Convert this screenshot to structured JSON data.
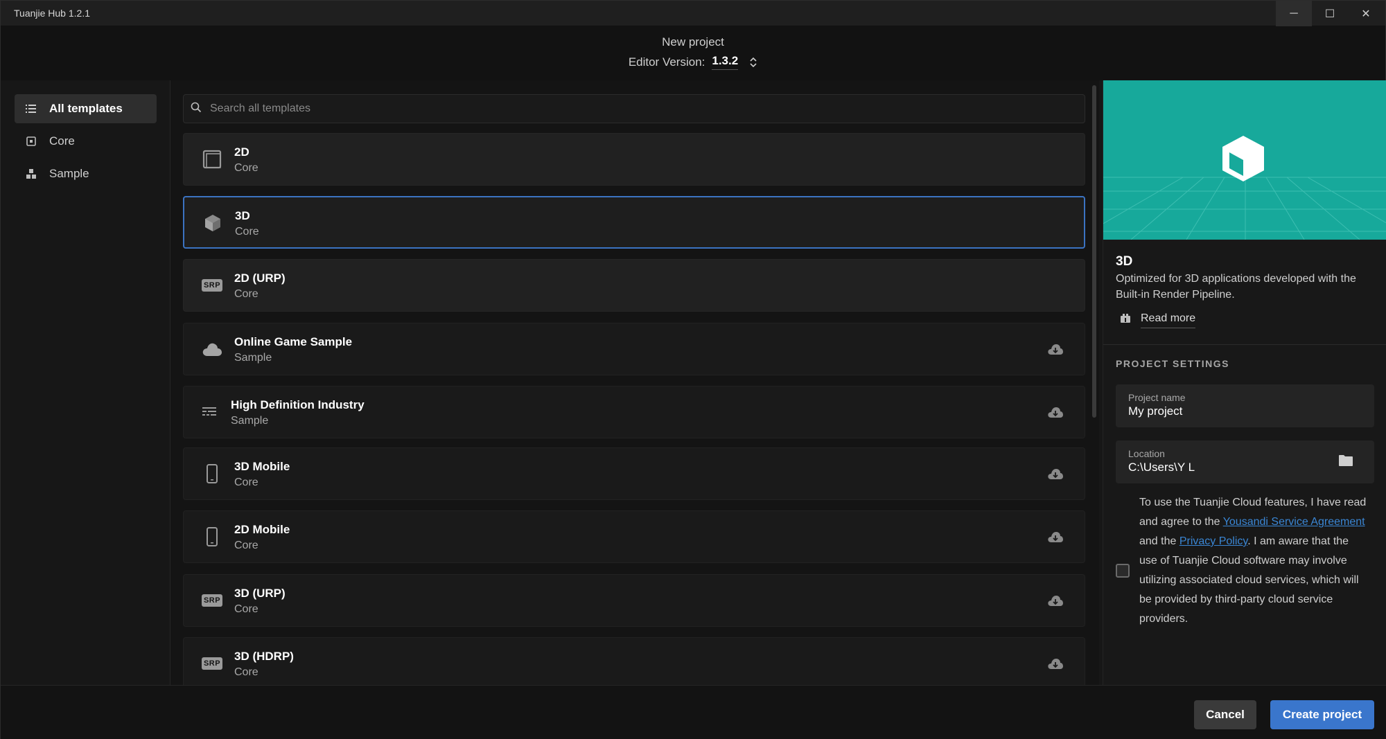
{
  "window": {
    "title": "Tuanjie Hub 1.2.1",
    "controls": {
      "minimize": "─",
      "maximize": "☐",
      "close": "✕"
    }
  },
  "header": {
    "title": "New project",
    "version_label": "Editor Version:",
    "version_value": "1.3.2"
  },
  "sidebar": {
    "items": [
      {
        "label": "All templates",
        "icon": "list-icon",
        "active": true
      },
      {
        "label": "Core",
        "icon": "core-icon",
        "active": false
      },
      {
        "label": "Sample",
        "icon": "sample-icon",
        "active": false
      }
    ]
  },
  "search": {
    "placeholder": "Search all templates"
  },
  "templates": [
    {
      "name": "2D",
      "category": "Core",
      "icon": "square-icon",
      "selected": false,
      "download": false
    },
    {
      "name": "3D",
      "category": "Core",
      "icon": "cube-icon",
      "selected": true,
      "download": false
    },
    {
      "name": "2D (URP)",
      "category": "Core",
      "icon": "srp-icon",
      "badge": "SRP",
      "selected": false,
      "download": false
    },
    {
      "name": "Online Game Sample",
      "category": "Sample",
      "icon": "cloud-icon",
      "selected": false,
      "download": true
    },
    {
      "name": "High Definition Industry",
      "category": "Sample",
      "icon": "industry-icon",
      "selected": false,
      "download": true
    },
    {
      "name": "3D Mobile",
      "category": "Core",
      "icon": "mobile-icon",
      "selected": false,
      "download": true
    },
    {
      "name": "2D Mobile",
      "category": "Core",
      "icon": "mobile-icon",
      "selected": false,
      "download": true
    },
    {
      "name": "3D (URP)",
      "category": "Core",
      "icon": "srp-icon",
      "badge": "SRP",
      "selected": false,
      "download": true
    },
    {
      "name": "3D (HDRP)",
      "category": "Core",
      "icon": "srp-icon",
      "badge": "SRP",
      "selected": false,
      "download": true
    }
  ],
  "detail": {
    "title": "3D",
    "description": "Optimized for 3D applications developed with the Built-in Render Pipeline.",
    "read_more": "Read more",
    "settings_label": "PROJECT SETTINGS",
    "project_name_label": "Project name",
    "project_name_value": "My project",
    "location_label": "Location",
    "location_value": "C:\\Users\\Y L",
    "agreement": {
      "part1": "To use the Tuanjie Cloud features, I have read and agree to the ",
      "link1": "Yousandi Service Agreement",
      "part2": " and the ",
      "link2": "Privacy Policy",
      "part3": ". I am aware that the use of Tuanjie Cloud software may involve utilizing associated cloud services, which will be provided by third-party cloud service providers."
    },
    "agree_checked": false
  },
  "footer": {
    "cancel_label": "Cancel",
    "create_label": "Create project"
  },
  "colors": {
    "accent": "#3a76cc",
    "selected_border": "#3b73c2",
    "preview_bg": "#16a99b",
    "link": "#3a86d4"
  }
}
